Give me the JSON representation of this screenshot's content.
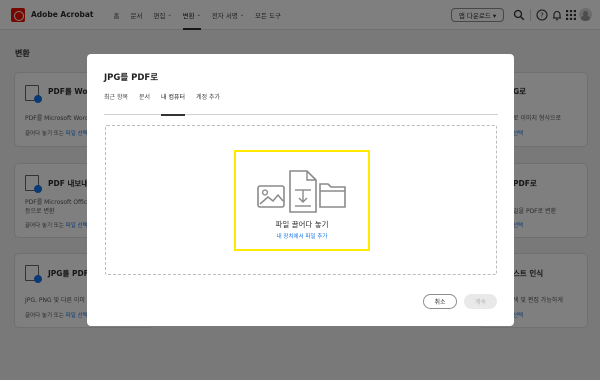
{
  "app": {
    "title": "Adobe Acrobat"
  },
  "nav": [
    {
      "label": "홈",
      "has_caret": false
    },
    {
      "label": "문서",
      "has_caret": false
    },
    {
      "label": "편집",
      "has_caret": true
    },
    {
      "label": "변환",
      "has_caret": true,
      "active": true
    },
    {
      "label": "전자 서명",
      "has_caret": true
    },
    {
      "label": "모든 도구",
      "has_caret": false
    }
  ],
  "toolbar": {
    "app_button_label": "앱 다운로드 ▾"
  },
  "icons": [
    "acrobat-logo-icon",
    "search-icon",
    "apps-grid-icon",
    "help-icon",
    "bell-icon",
    "avatar"
  ],
  "page": {
    "title": "변환"
  },
  "cards": {
    "pdf_to_word": {
      "title": "PDF를 Word",
      "desc": "PDF를 Microsoft Word",
      "link_prefix": "끌어다 놓기 또는",
      "link_label": "파일 선택"
    },
    "pdf_export": {
      "title": "PDF 내보내기",
      "desc1": "PDF를 Microsoft Offic",
      "desc2": "등으로 변환",
      "link_prefix": "끌어다 놓기 또는",
      "link_label": "파일 선택"
    },
    "jpg_to_pdf": {
      "title": "JPG를 PDF로",
      "desc": "JPG, PNG 및 다른 이미",
      "link_prefix": "끌어다 놓기 또는",
      "link_label": "파일 선택"
    },
    "right_1": {
      "title": "G로",
      "desc": "로 이미지 형식으로",
      "link_label": "선택"
    },
    "right_2": {
      "title": "PDF로",
      "desc": "일을 PDF로 변환",
      "link_label": "선택"
    },
    "right_3": {
      "title": "스트 인식",
      "desc": "색 및 편집 가능하게",
      "link_label": "선택"
    }
  },
  "modal": {
    "title": "JPG를 PDF로",
    "tabs": [
      {
        "label": "최근 항목"
      },
      {
        "label": "문서"
      },
      {
        "label": "내 컴퓨터",
        "active": true
      },
      {
        "label": "계정 추가"
      }
    ],
    "drop_label": "파일 끌어다 놓기",
    "drop_link": "내 장치에서 파일 추가",
    "cancel_label": "취소",
    "continue_label": "계속"
  },
  "colors": {
    "accent": "#1473e6",
    "brand": "#eb1000",
    "highlight": "#ffea00"
  }
}
